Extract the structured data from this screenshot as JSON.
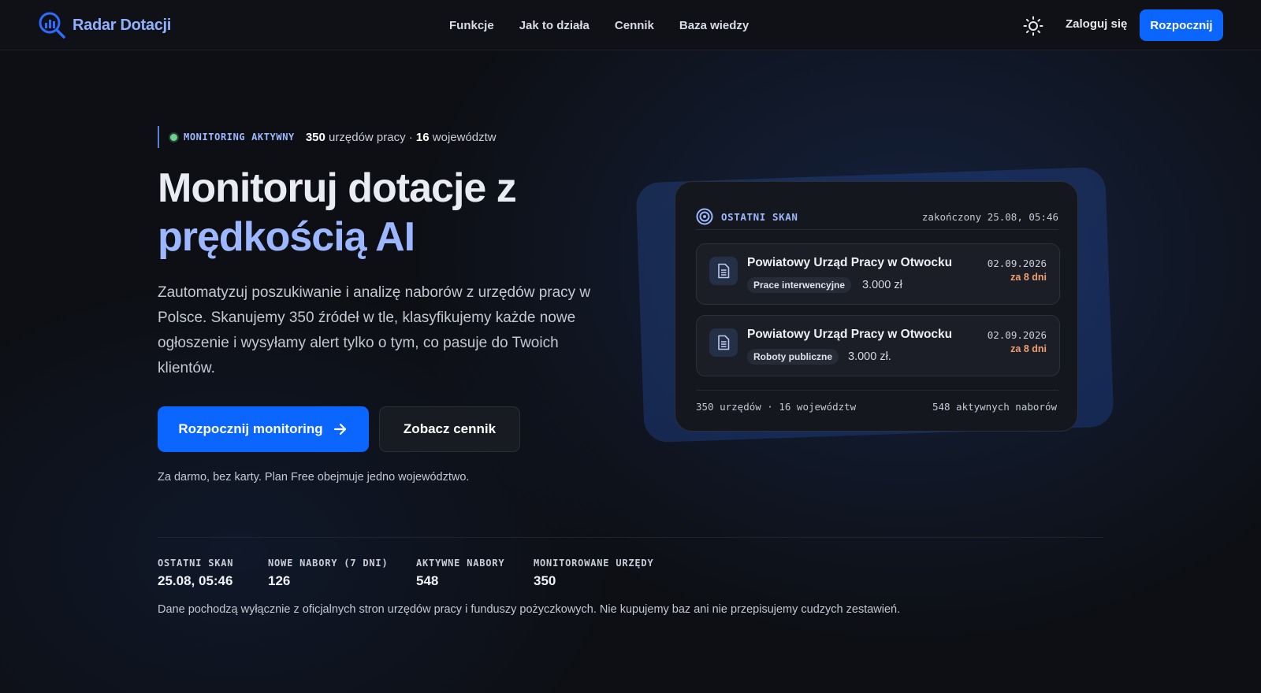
{
  "brand": {
    "name": "Radar Dotacji",
    "icon": "radar-search-icon"
  },
  "nav": {
    "links": [
      "Funkcje",
      "Jak to działa",
      "Cennik",
      "Baza wiedzy"
    ],
    "theme_icon": "sun-icon",
    "login": "Zaloguj się",
    "cta": "Rozpocznij"
  },
  "hero": {
    "status_label": "MONITORING AKTYWNY",
    "offices_count": "350",
    "offices_text": " urzędów pracy · ",
    "regions_count": "16",
    "regions_text": " województw",
    "headline_line1": "Monitoruj dotacje z",
    "headline_line2": "prędkością AI",
    "lead": "Zautomatyzuj poszukiwanie i analizę naborów z urzędów pracy w Polsce. Skanujemy 350 źródeł w tle, klasyfikujemy każde nowe ogłoszenie i wysyłamy alert tylko o tym, co pasuje do Twoich klientów.",
    "primary_button": "Rozpocznij monitoring",
    "secondary_button": "Zobacz cennik",
    "note": "Za darmo, bez karty. Plan Free obejmuje jedno województwo."
  },
  "scan_card": {
    "title": "OSTATNI SKAN",
    "meta": "zakończony 25.08, 05:46",
    "items": [
      {
        "title": "Powiatowy Urząd Pracy w Otwocku",
        "tag": "Prace interwencyjne",
        "amount": "3.000 zł",
        "date": "02.09.2026",
        "due": "za 8 dni"
      },
      {
        "title": "Powiatowy Urząd Pracy w Otwocku",
        "tag": "Roboty publiczne",
        "amount": "3.000 zł.",
        "date": "02.09.2026",
        "due": "za 8 dni"
      }
    ],
    "footer_left": "350 urzędów · 16 województw",
    "footer_right": "548 aktywnych naborów"
  },
  "stats": [
    {
      "label": "OSTATNI SKAN",
      "value": "25.08, 05:46"
    },
    {
      "label": "NOWE NABORY (7 DNI)",
      "value": "126"
    },
    {
      "label": "AKTYWNE NABORY",
      "value": "548"
    },
    {
      "label": "MONITOROWANE URZĘDY",
      "value": "350"
    }
  ],
  "disclaimer": "Dane pochodzą wyłącznie z oficjalnych stron urzędów pracy i funduszy pożyczkowych. Nie kupujemy baz ani nie przepisujemy cudzych zestawień.",
  "colors": {
    "accent": "#0a66ff",
    "headline_accent": "#9cb6ff",
    "status_dot": "#6fd28f",
    "due": "#f0a070"
  }
}
